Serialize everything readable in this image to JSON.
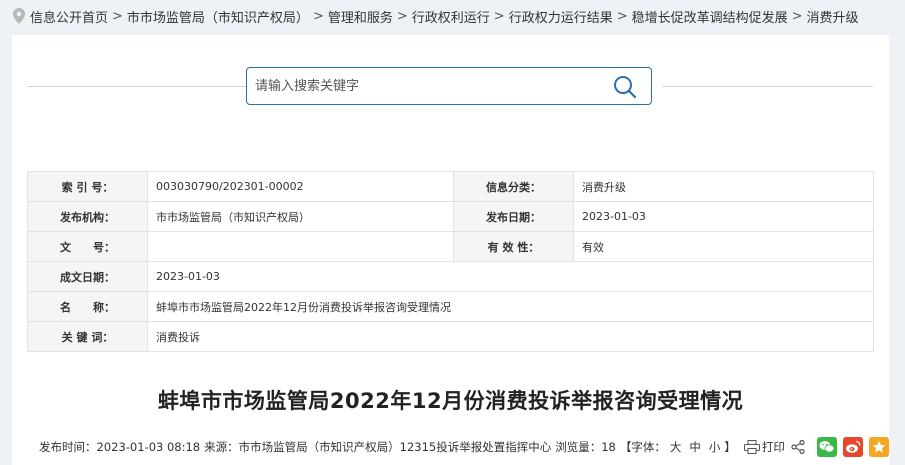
{
  "breadcrumb": {
    "items": [
      "信息公开首页",
      "市市场监管局（市知识产权局）",
      "管理和服务",
      "行政权利运行",
      "行政权力运行结果",
      "稳增长促改革调结构促发展",
      "消费升级"
    ],
    "separator": ">"
  },
  "search": {
    "placeholder": "请输入搜索关键字"
  },
  "meta": {
    "index_label": "索 引 号：",
    "index_value": "003030790/202301-00002",
    "category_label": "信息分类：",
    "category_value": "消费升级",
    "publisher_label": "发布机构：",
    "publisher_value": "市市场监管局（市知识产权局）",
    "pubdate_label": "发布日期：",
    "pubdate_value": "2023-01-03",
    "docno_label": "文　　号：",
    "docno_value": "",
    "validity_label": "有 效 性：",
    "validity_value": "有效",
    "created_label": "成文日期：",
    "created_value": "2023-01-03",
    "name_label": "名　　称：",
    "name_value": "蚌埠市市场监管局2022年12月份消费投诉举报咨询受理情况",
    "keywords_label": "关 键 词：",
    "keywords_value": "消费投诉"
  },
  "article": {
    "title": "蚌埠市市场监管局2022年12月份消费投诉举报咨询受理情况",
    "pubtime": "发布时间：2023-01-03 08:18",
    "source": "来源：市市场监管局（市知识产权局）12315投诉举报处置指挥中心",
    "views": "浏览量：18",
    "font_prefix": "【字体：",
    "font_large": "大",
    "font_medium": "中",
    "font_small": "小",
    "font_suffix": "】",
    "print_label": "打印"
  },
  "colors": {
    "accent": "#2a6fb0",
    "wechat": "#3bb84a",
    "weibo": "#e6452e",
    "favorite": "#f5a623"
  }
}
